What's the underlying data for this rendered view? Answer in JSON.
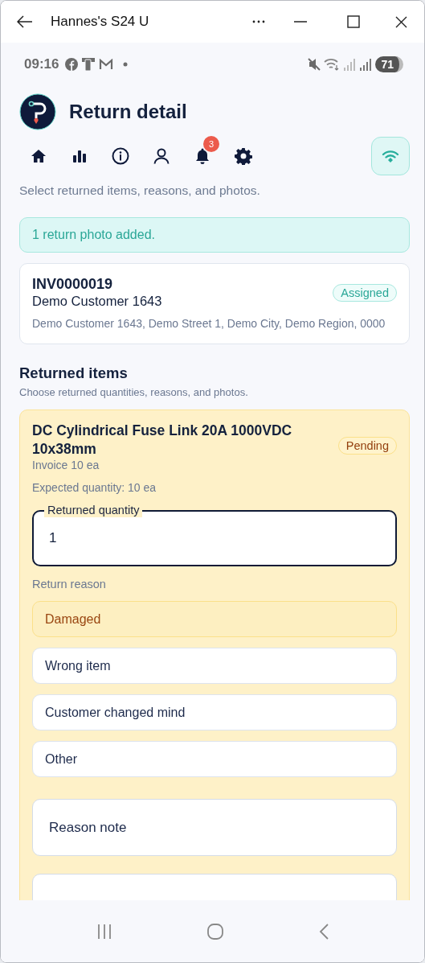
{
  "window": {
    "title": "Hannes's S24 U"
  },
  "status_bar": {
    "time": "09:16",
    "battery": "71"
  },
  "header": {
    "title": "Return detail",
    "nav": [
      {
        "kind": "home"
      },
      {
        "kind": "chart"
      },
      {
        "kind": "info"
      },
      {
        "kind": "person"
      },
      {
        "kind": "bell",
        "badge": "3"
      },
      {
        "kind": "settings"
      }
    ],
    "subtitle": "Select returned items, reasons, and photos."
  },
  "banner": "1 return photo added.",
  "customer": {
    "invoice": "INV0000019",
    "name": "Demo Customer 1643",
    "status": "Assigned",
    "address": "Demo Customer 1643, Demo Street 1, Demo City, Demo Region, 0000"
  },
  "section": {
    "title": "Returned items",
    "subtitle": "Choose returned quantities, reasons, and photos."
  },
  "items": [
    {
      "name": "DC Cylindrical Fuse Link 20A 1000VDC 10x38mm",
      "status": "Pending",
      "invoice_qty": "Invoice 10 ea",
      "expected": "Expected quantity: 10 ea",
      "quantity_label": "Returned quantity",
      "quantity_value": "1",
      "reason_label": "Return reason",
      "reasons": [
        {
          "label": "Damaged",
          "selected": true
        },
        {
          "label": "Wrong item",
          "selected": false
        },
        {
          "label": "Customer changed mind",
          "selected": false
        },
        {
          "label": "Other",
          "selected": false
        }
      ],
      "note_placeholder": "Reason note"
    }
  ]
}
